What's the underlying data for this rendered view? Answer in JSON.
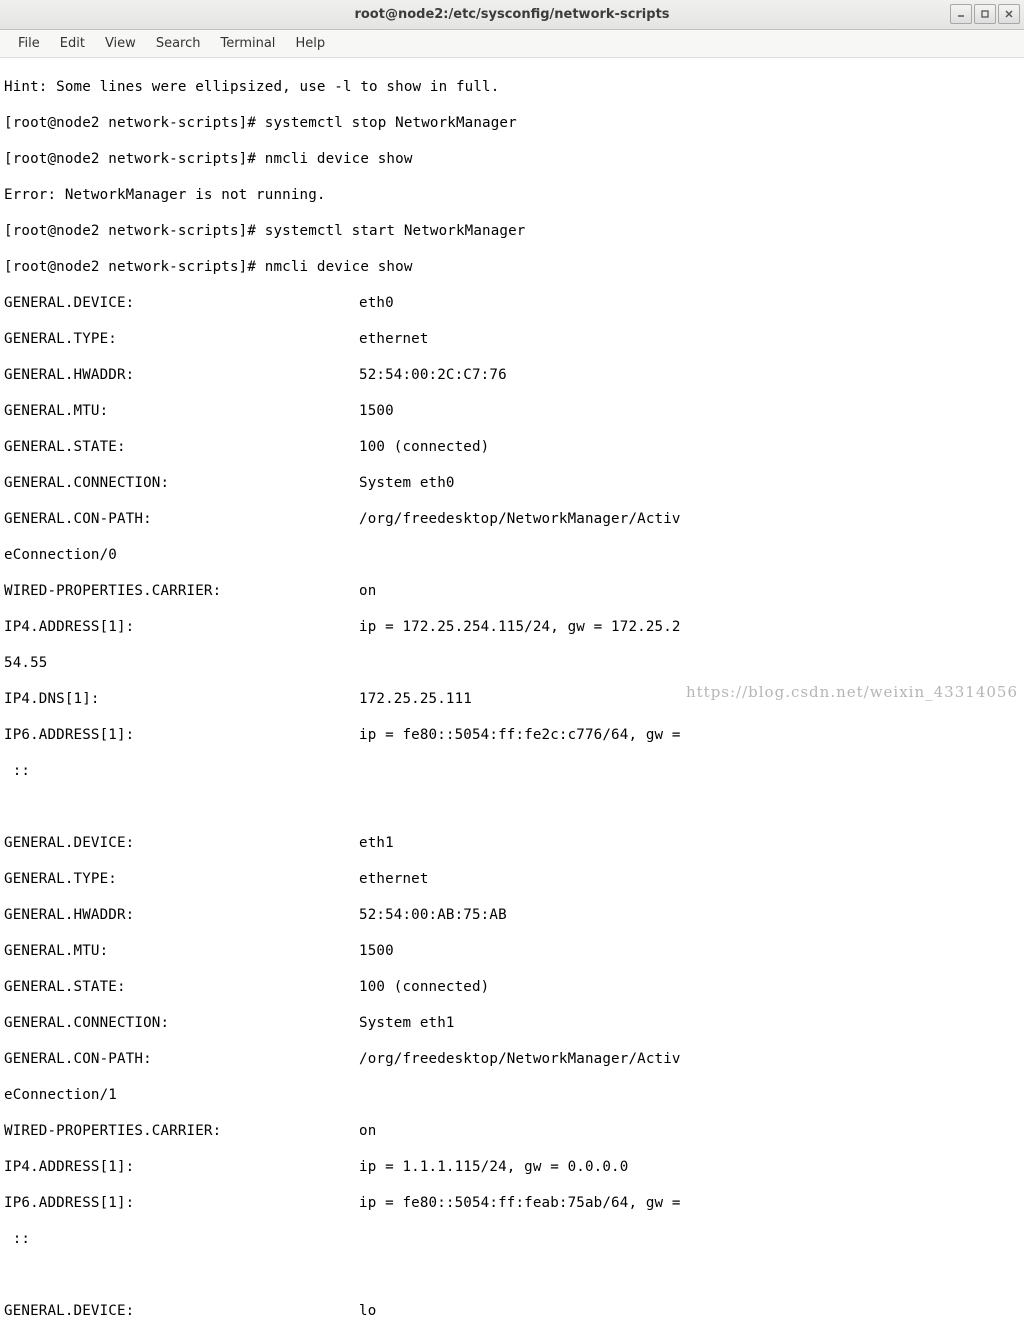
{
  "window": {
    "title": "root@node2:/etc/sysconfig/network-scripts"
  },
  "menu": {
    "file": "File",
    "edit": "Edit",
    "view": "View",
    "search": "Search",
    "terminal": "Terminal",
    "help": "Help"
  },
  "lines": {
    "hint": "Hint: Some lines were ellipsized, use -l to show in full.",
    "p1": "[root@node2 network-scripts]# systemctl stop NetworkManager",
    "p2": "[root@node2 network-scripts]# nmcli device show",
    "err": "Error: NetworkManager is not running.",
    "p3": "[root@node2 network-scripts]# systemctl start NetworkManager",
    "p4": "[root@node2 network-scripts]# nmcli device show"
  },
  "dev0": {
    "device_k": "GENERAL.DEVICE:",
    "device_v": "eth0",
    "type_k": "GENERAL.TYPE:",
    "type_v": "ethernet",
    "hwaddr_k": "GENERAL.HWADDR:",
    "hwaddr_v": "52:54:00:2C:C7:76",
    "mtu_k": "GENERAL.MTU:",
    "mtu_v": "1500",
    "state_k": "GENERAL.STATE:",
    "state_v": "100 (connected)",
    "conn_k": "GENERAL.CONNECTION:",
    "conn_v": "System eth0",
    "conpath_k": "GENERAL.CON-PATH:",
    "conpath_v": "/org/freedesktop/NetworkManager/Activ",
    "conpath_wrap": "eConnection/0",
    "carrier_k": "WIRED-PROPERTIES.CARRIER:",
    "carrier_v": "on",
    "ip4addr_k": "IP4.ADDRESS[1]:",
    "ip4addr_v": "ip = 172.25.254.115/24, gw = 172.25.2",
    "ip4addr_wrap": "54.55",
    "ip4dns_k": "IP4.DNS[1]:",
    "ip4dns_v": "172.25.25.111",
    "ip6addr_k": "IP6.ADDRESS[1]:",
    "ip6addr_v": "ip = fe80::5054:ff:fe2c:c776/64, gw =",
    "ip6addr_wrap": " ::"
  },
  "dev1": {
    "device_k": "GENERAL.DEVICE:",
    "device_v": "eth1",
    "type_k": "GENERAL.TYPE:",
    "type_v": "ethernet",
    "hwaddr_k": "GENERAL.HWADDR:",
    "hwaddr_v": "52:54:00:AB:75:AB",
    "mtu_k": "GENERAL.MTU:",
    "mtu_v": "1500",
    "state_k": "GENERAL.STATE:",
    "state_v": "100 (connected)",
    "conn_k": "GENERAL.CONNECTION:",
    "conn_v": "System eth1",
    "conpath_k": "GENERAL.CON-PATH:",
    "conpath_v": "/org/freedesktop/NetworkManager/Activ",
    "conpath_wrap": "eConnection/1",
    "carrier_k": "WIRED-PROPERTIES.CARRIER:",
    "carrier_v": "on",
    "ip4addr_k": "IP4.ADDRESS[1]:",
    "ip4addr_v": "ip = 1.1.1.115/24, gw = 0.0.0.0",
    "ip6addr_k": "IP6.ADDRESS[1]:",
    "ip6addr_v": "ip = fe80::5054:ff:feab:75ab/64, gw =",
    "ip6addr_wrap": " ::"
  },
  "dev2": {
    "device_k": "GENERAL.DEVICE:",
    "device_v": "lo"
  },
  "watermark": "https://blog.csdn.net/weixin_43314056"
}
